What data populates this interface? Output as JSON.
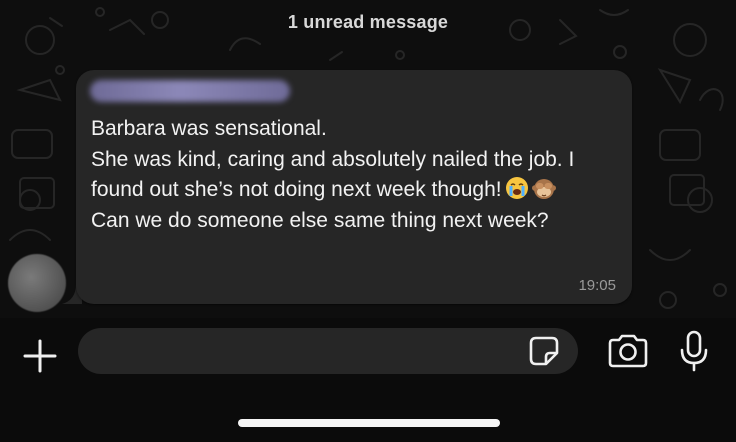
{
  "chat": {
    "unread_banner": "1 unread message",
    "message": {
      "sender": "",
      "lines": [
        "Barbara was sensational.",
        "She was kind, caring and absolutely nailed the job. I found out she’s not doing next week though!",
        "Can we do someone else same thing next week?"
      ],
      "emojis": [
        "loudly-crying-face",
        "see-no-evil-monkey"
      ],
      "time": "19:05"
    }
  },
  "composer": {
    "input_value": "",
    "icons": [
      "plus-icon",
      "sticker-icon",
      "camera-icon",
      "microphone-icon"
    ]
  },
  "colors": {
    "background": "#0e0e0e",
    "bubble": "#262626",
    "text": "#f2f2f2",
    "timestamp": "#9a9a9a",
    "input": "#262626"
  }
}
